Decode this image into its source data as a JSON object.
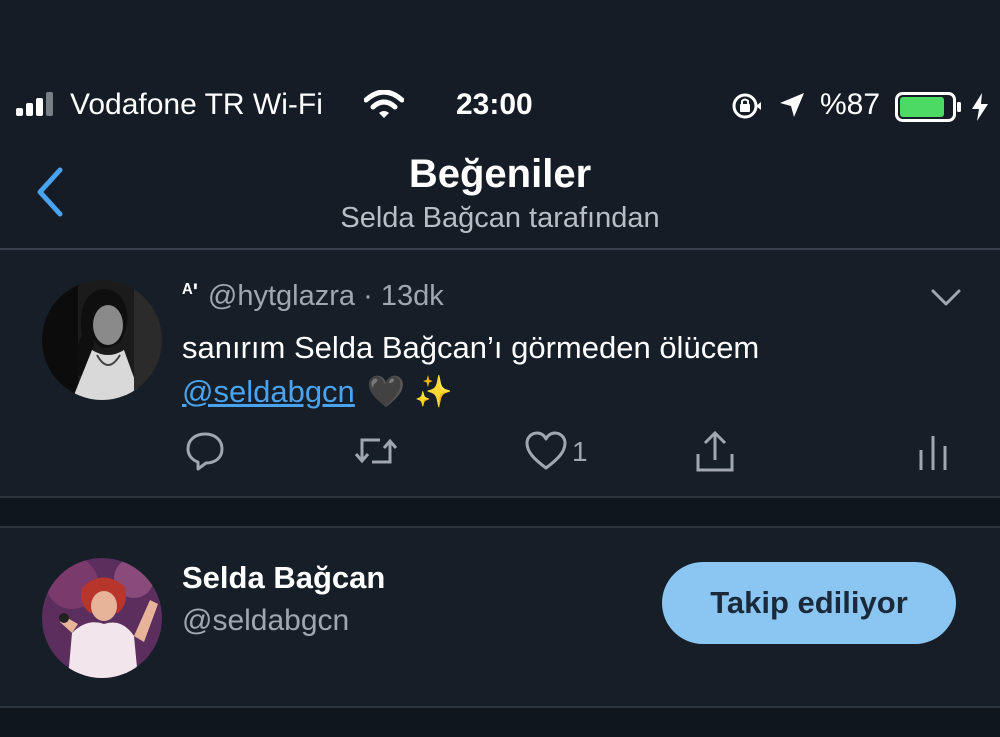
{
  "status_bar": {
    "carrier": "Vodafone TR Wi-Fi",
    "time": "23:00",
    "battery": "%87",
    "battery_level": 0.87,
    "icons": [
      "signal-icon",
      "wifi-icon",
      "rotation-lock-icon",
      "location-icon",
      "battery-icon",
      "charging-icon"
    ]
  },
  "nav": {
    "title": "Beğeniler",
    "subtitle": "Selda Bağcan tarafından"
  },
  "tweet": {
    "display_name": "ᴬ'",
    "handle": "@hytglazra",
    "separator": "·",
    "time": "13dk",
    "text": "sanırım Selda Bağcan’ı görmeden ölücem",
    "mention": "@seldabgcn",
    "emojis": "🖤 ✨",
    "like_count": "1",
    "actions": [
      "reply-icon",
      "retweet-icon",
      "like-icon",
      "share-icon",
      "analytics-icon"
    ]
  },
  "user": {
    "name": "Selda Bağcan",
    "handle": "@seldabgcn",
    "follow_label": "Takip ediliyor"
  },
  "colors": {
    "background": "#151c26",
    "accent": "#4aa3ee",
    "follow_button": "#8bc6f3",
    "battery": "#4cd964"
  }
}
